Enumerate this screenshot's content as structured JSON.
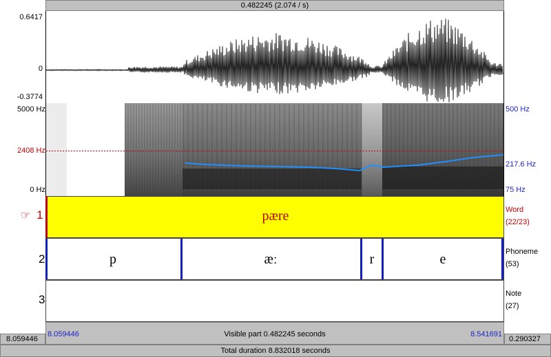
{
  "top_bar": "0.482245 (2.074 / s)",
  "waveform": {
    "max": "0.6417",
    "zero": "0",
    "min": "-0.3774"
  },
  "spectrogram": {
    "freq_top": "5000 Hz",
    "freq_cursor": "2408 Hz",
    "freq_bottom": "0 Hz",
    "pitch_top": "500 Hz",
    "pitch_value": "217.6 Hz",
    "pitch_bottom": "75 Hz",
    "pitch_color": "#1e90ff",
    "cursor_color": "#c00000"
  },
  "tiers": [
    {
      "number": "1",
      "name": "Word",
      "count": "(22/23)",
      "intervals": [
        "pære"
      ],
      "selected": true,
      "highlight": "#ffff00"
    },
    {
      "number": "2",
      "name": "Phoneme",
      "count": "(53)",
      "intervals": [
        "p",
        "æː",
        "r",
        "e"
      ]
    },
    {
      "number": "3",
      "name": "Note",
      "count": "(27)",
      "intervals": []
    }
  ],
  "pointer_symbol": "☞",
  "bottom": {
    "left_time": "8.059446",
    "visible_start": "8.059446",
    "visible_label": "Visible part 0.482245 seconds",
    "visible_end": "8.541691",
    "right_time": "0.290327",
    "total": "Total duration 8.832018 seconds"
  }
}
